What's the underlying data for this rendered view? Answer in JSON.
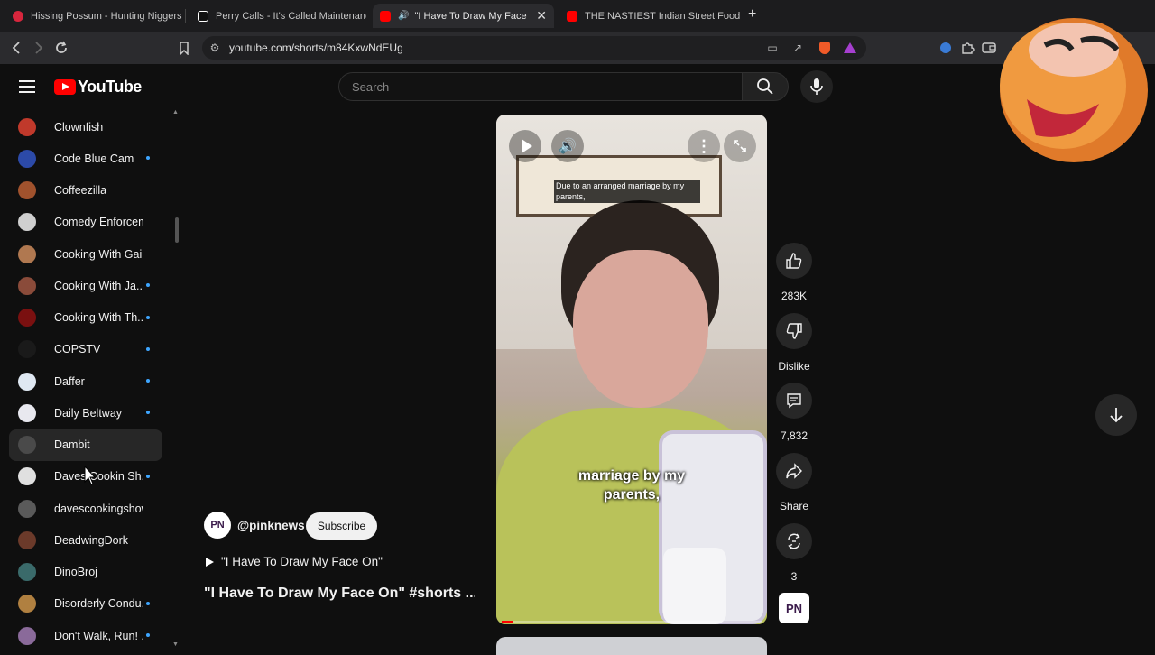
{
  "browser": {
    "tabs": [
      {
        "title": "Hissing Possum - Hunting Niggers in",
        "favicon_color": "#d7263d"
      },
      {
        "title": "Perry Calls - It's Called Maintenance |",
        "favicon_color": "#ffffff"
      },
      {
        "title": "\"I Have To Draw My Face On\"",
        "favicon_color": "#ff0000",
        "active": true
      },
      {
        "title": "THE NASTIEST Indian Street Food Co",
        "favicon_color": "#ff0000"
      }
    ],
    "url": "youtube.com/shorts/m84KxwNdEUg"
  },
  "header": {
    "logo_text": "YouTube",
    "search_placeholder": "Search"
  },
  "sidebar": {
    "subscriptions": [
      {
        "name": "Clownfish",
        "color": "#c0392b",
        "dot": false
      },
      {
        "name": "Code Blue Cam",
        "color": "#2c4aa8",
        "dot": true
      },
      {
        "name": "Coffeezilla",
        "color": "#a0522d",
        "dot": false
      },
      {
        "name": "Comedy Enforceme...",
        "color": "#cfcfcf",
        "dot": false
      },
      {
        "name": "Cooking With Gail",
        "color": "#b07850",
        "dot": false
      },
      {
        "name": "Cooking With Ja...",
        "color": "#8a4b3a",
        "dot": true
      },
      {
        "name": "Cooking With Th...",
        "color": "#7a1010",
        "dot": true
      },
      {
        "name": "COPSTV",
        "color": "#1a1a1a",
        "dot": true
      },
      {
        "name": "Daffer",
        "color": "#dfe8f2",
        "dot": true
      },
      {
        "name": "Daily Beltway",
        "color": "#e8e8ef",
        "dot": true
      },
      {
        "name": "Dambit",
        "color": "#4a4a4a",
        "dot": false,
        "hover": true
      },
      {
        "name": "Daves Cookin Sh...",
        "color": "#e0e0e0",
        "dot": true
      },
      {
        "name": "davescookingshow",
        "color": "#5a5a5a",
        "dot": false
      },
      {
        "name": "DeadwingDork",
        "color": "#6b3a2a",
        "dot": false
      },
      {
        "name": "DinoBroj",
        "color": "#3a6a6a",
        "dot": false
      },
      {
        "name": "Disorderly Condu...",
        "color": "#b08040",
        "dot": true
      },
      {
        "name": "Don't Walk, Run! ...",
        "color": "#8a6a9a",
        "dot": true
      }
    ]
  },
  "video": {
    "caption_top": "Due to an arranged marriage by my parents,",
    "caption_mid": "marriage by my parents,",
    "progress": 0.04
  },
  "actions": {
    "like_count": "283K",
    "dislike_label": "Dislike",
    "comment_count": "7,832",
    "share_label": "Share",
    "remix_count": "3"
  },
  "channel": {
    "avatar_text": "PN",
    "handle": "@pinknews",
    "subscribe_label": "Subscribe",
    "sound_title": "\"I Have To Draw My Face On\"",
    "video_title": "\"I Have To Draw My Face On\" #shorts ..."
  }
}
